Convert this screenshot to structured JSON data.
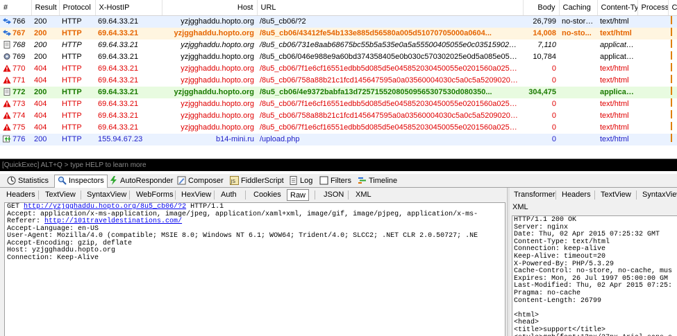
{
  "grid": {
    "columns": [
      "#",
      "Result",
      "Protocol",
      "X-HostIP",
      "Host",
      "URL",
      "Body",
      "Caching",
      "Content-Type",
      "Process",
      "C"
    ],
    "rows": [
      {
        "num": "766",
        "result": "200",
        "protocol": "HTTP",
        "ip": "69.64.33.21",
        "host": "yzjgghaddu.hopto.org",
        "url": "/8u5_cb06/?2",
        "body": "26,799",
        "caching": "no-store...",
        "ctype": "text/html",
        "style": "black",
        "icon": "arrows-icon"
      },
      {
        "num": "767",
        "result": "200",
        "protocol": "HTTP",
        "ip": "69.64.33.21",
        "host": "yzjgghaddu.hopto.org",
        "url": "/8u5_cb06/43412fe54b133e885d56580a005d51070705000a0604...",
        "body": "14,008",
        "caching": "no-sto...",
        "ctype": "text/html",
        "style": "orange",
        "icon": "arrows-icon"
      },
      {
        "num": "768",
        "result": "200",
        "protocol": "HTTP",
        "ip": "69.64.33.21",
        "host": "yzjgghaddu.hopto.org",
        "url": "/8u5_cb06/731e8aab68675bc55b5a535e0a5a55500405055e0c0351590206...",
        "body": "7,110",
        "caching": "",
        "ctype": "application/...",
        "style": "black italic",
        "icon": "document-icon"
      },
      {
        "num": "769",
        "result": "200",
        "protocol": "HTTP",
        "ip": "69.64.33.21",
        "host": "yzjgghaddu.hopto.org",
        "url": "/8u5_cb06/046e988e9a60bd374358405e0b030c570302025e0d5a085e0501...",
        "body": "10,784",
        "caching": "",
        "ctype": "application/...",
        "style": "black",
        "icon": "gear-icon"
      },
      {
        "num": "770",
        "result": "404",
        "protocol": "HTTP",
        "ip": "69.64.33.21",
        "host": "yzjgghaddu.hopto.org",
        "url": "/8u5_cb06/7f1e6cf16551edbb5d085d5e045852030450055e0201560a02530...",
        "body": "0",
        "caching": "",
        "ctype": "text/html",
        "style": "red",
        "icon": "warning-icon"
      },
      {
        "num": "771",
        "result": "404",
        "protocol": "HTTP",
        "ip": "69.64.33.21",
        "host": "yzjgghaddu.hopto.org",
        "url": "/8u5_cb06/758a88b21c1fcd145647595a0a03560004030c5a0c5a520902000...",
        "body": "0",
        "caching": "",
        "ctype": "text/html",
        "style": "red",
        "icon": "warning-icon"
      },
      {
        "num": "772",
        "result": "200",
        "protocol": "HTTP",
        "ip": "69.64.33.21",
        "host": "yzjgghaddu.hopto.org",
        "url": "/8u5_cb06/4e9372babfa13d72571552080509565307530d080350...",
        "body": "304,475",
        "caching": "",
        "ctype": "applicatio...",
        "style": "green",
        "icon": "document-icon"
      },
      {
        "num": "773",
        "result": "404",
        "protocol": "HTTP",
        "ip": "69.64.33.21",
        "host": "yzjgghaddu.hopto.org",
        "url": "/8u5_cb06/7f1e6cf16551edbb5d085d5e045852030450055e0201560a02530...",
        "body": "0",
        "caching": "",
        "ctype": "text/html",
        "style": "red",
        "icon": "warning-icon"
      },
      {
        "num": "774",
        "result": "404",
        "protocol": "HTTP",
        "ip": "69.64.33.21",
        "host": "yzjgghaddu.hopto.org",
        "url": "/8u5_cb06/758a88b21c1fcd145647595a0a03560004030c5a0c5a520902000...",
        "body": "0",
        "caching": "",
        "ctype": "text/html",
        "style": "red",
        "icon": "warning-icon"
      },
      {
        "num": "775",
        "result": "404",
        "protocol": "HTTP",
        "ip": "69.64.33.21",
        "host": "yzjgghaddu.hopto.org",
        "url": "/8u5_cb06/7f1e6cf16551edbb5d085d5e045852030450055e0201560a02530...",
        "body": "0",
        "caching": "",
        "ctype": "text/html",
        "style": "red",
        "icon": "warning-icon"
      },
      {
        "num": "776",
        "result": "200",
        "protocol": "HTTP",
        "ip": "155.94.67.23",
        "host": "b14-mini.ru",
        "url": "/upload.php",
        "body": "0",
        "caching": "",
        "ctype": "text/html",
        "style": "blue",
        "icon": "upload-icon"
      }
    ]
  },
  "quickexec": {
    "placeholder": "[QuickExec] ALT+Q > type HELP to learn more"
  },
  "toptabs": [
    "Statistics",
    "Inspectors",
    "AutoResponder",
    "Composer",
    "FiddlerScript",
    "Log",
    "Filters",
    "Timeline"
  ],
  "request": {
    "tabs": [
      "Headers",
      "TextView",
      "SyntaxView",
      "WebForms",
      "HexView",
      "Auth",
      "Cookies",
      "Raw",
      "JSON",
      "XML"
    ],
    "method": "GET",
    "url": "http://yzjgghaddu.hopto.org/8u5_cb06/?2",
    "version": "HTTP/1.1",
    "line2": "Accept: application/x-ms-application, image/jpeg, application/xaml+xml, image/gif, image/pjpeg, application/x-ms-",
    "referer_label": "Referer:",
    "referer_url": "http://101traveldestinations.com/",
    "line4": "Accept-Language: en-US",
    "line5": "User-Agent: Mozilla/4.0 (compatible; MSIE 8.0; Windows NT 6.1; WOW64; Trident/4.0; SLCC2; .NET CLR 2.0.50727; .NE",
    "line6": "Accept-Encoding: gzip, deflate",
    "line7": "Host: yzjgghaddu.hopto.org",
    "line8": "Connection: Keep-Alive"
  },
  "response": {
    "tabs": [
      "Transformer",
      "Headers",
      "TextView",
      "SyntaxView",
      "XML"
    ],
    "text": "HTTP/1.1 200 OK\nServer: nginx\nDate: Thu, 02 Apr 2015 07:25:32 GMT\nContent-Type: text/html\nConnection: keep-alive\nKeep-Alive: timeout=20\nX-Powered-By: PHP/5.3.29\nCache-Control: no-store, no-cache, mus\nExpires: Mon, 26 Jul 1997 05:00:00 GM\nLast-Modified: Thu, 02 Apr 2015 07:25:\nPragma: no-cache\nContent-Length: 26799\n\n<html>\n<head>\n<title>support</title>\n<style>#gb{font:13px/27px Arial,sans-s"
  },
  "colors": {
    "black": "#000000",
    "blue": "#1c1cc8",
    "red": "#e00000",
    "orange": "#e56500",
    "green": "#1a7a00"
  }
}
